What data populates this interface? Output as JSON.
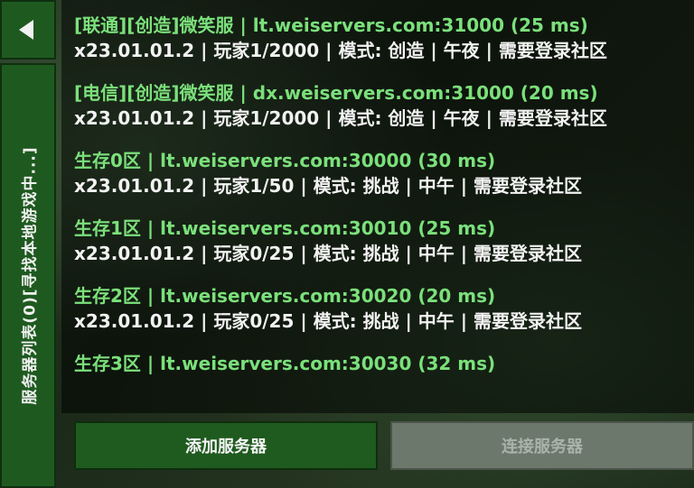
{
  "sidebar": {
    "title": "服务器列表(0)[寻找本地游戏中...]"
  },
  "servers": [
    {
      "title": "[联通][创造]微笑服 | lt.weiservers.com:31000 (25 ms)",
      "info": "x23.01.01.2 | 玩家1/2000 | 模式: 创造 | 午夜 | 需要登录社区"
    },
    {
      "title": "[电信][创造]微笑服 | dx.weiservers.com:31000 (20 ms)",
      "info": "x23.01.01.2 | 玩家1/2000 | 模式: 创造 | 午夜 | 需要登录社区"
    },
    {
      "title": "生存0区 | lt.weiservers.com:30000 (30 ms)",
      "info": "x23.01.01.2 | 玩家1/50 | 模式: 挑战 | 中午 | 需要登录社区"
    },
    {
      "title": "生存1区 | lt.weiservers.com:30010 (25 ms)",
      "info": "x23.01.01.2 | 玩家0/25 | 模式: 挑战 | 中午 | 需要登录社区"
    },
    {
      "title": "生存2区 | lt.weiservers.com:30020 (20 ms)",
      "info": "x23.01.01.2 | 玩家0/25 | 模式: 挑战 | 中午 | 需要登录社区"
    },
    {
      "title": "生存3区 | lt.weiservers.com:30030 (32 ms)",
      "info": ""
    }
  ],
  "buttons": {
    "add_server": "添加服务器",
    "connect_server": "连接服务器"
  },
  "colors": {
    "server_title": "#7be07b",
    "button_green": "#1f5a1f",
    "button_disabled": "#6d786c"
  }
}
